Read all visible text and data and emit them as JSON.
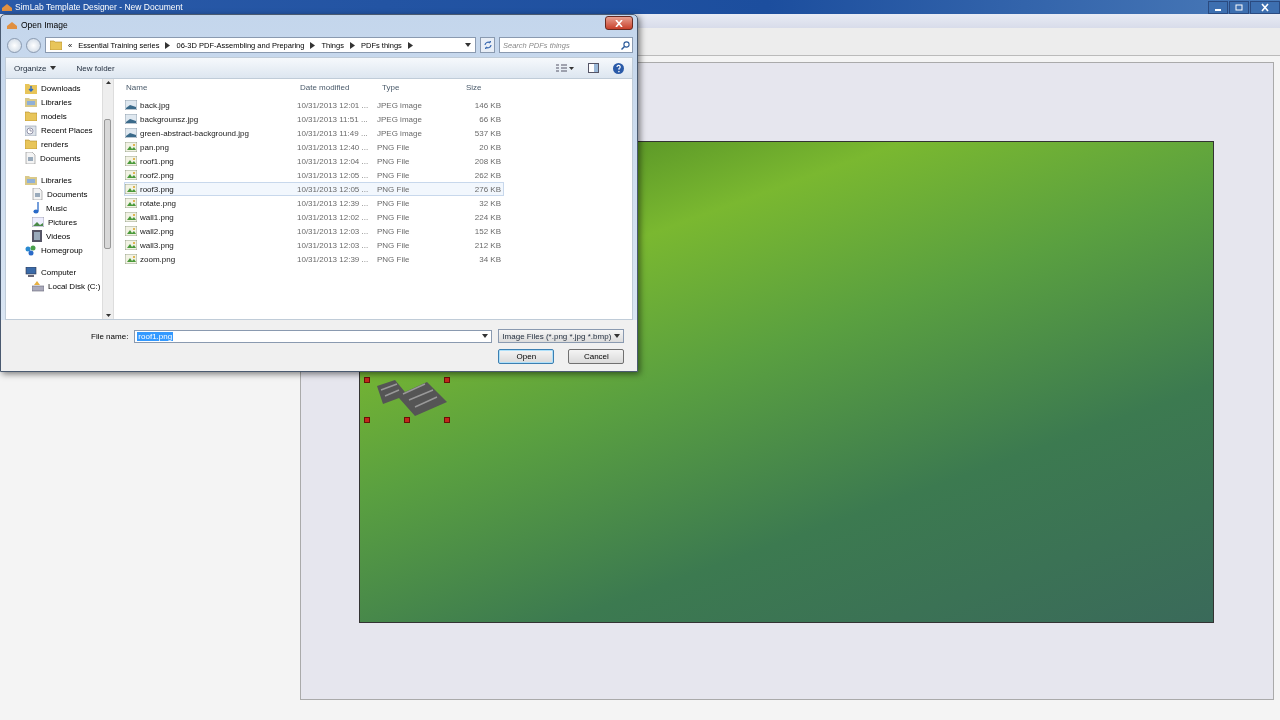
{
  "app": {
    "title": "SimLab Template Designer - New Document"
  },
  "canvas": {
    "items": [
      {
        "kind": "background",
        "selected": false
      },
      {
        "kind": "roof",
        "selected": true
      }
    ]
  },
  "dialog": {
    "title": "Open Image",
    "overflow_mark": "«",
    "breadcrumbs": [
      "Essential Training series",
      "06-3D PDF-Assembling and Preparing",
      "Things",
      "PDFs things"
    ],
    "search": {
      "placeholder": "Search PDFs things"
    },
    "commands": [
      {
        "label": "Organize",
        "dropdown": true
      },
      {
        "label": "New folder",
        "dropdown": false
      }
    ],
    "nav": [
      {
        "label": "Downloads",
        "kind": "downloads"
      },
      {
        "label": "Libraries",
        "kind": "library"
      },
      {
        "label": "models",
        "kind": "folder"
      },
      {
        "label": "Recent Places",
        "kind": "recent"
      },
      {
        "label": "renders",
        "kind": "folder"
      },
      {
        "label": "Documents",
        "kind": "document"
      },
      {
        "label": "Libraries",
        "kind": "library",
        "children": [
          {
            "label": "Documents",
            "kind": "document"
          },
          {
            "label": "Music",
            "kind": "music"
          },
          {
            "label": "Pictures",
            "kind": "pictures"
          },
          {
            "label": "Videos",
            "kind": "videos"
          }
        ]
      },
      {
        "label": "Homegroup",
        "kind": "homegroup"
      },
      {
        "label": "Computer",
        "kind": "computer",
        "children": [
          {
            "label": "Local Disk (C:)",
            "kind": "disk"
          }
        ]
      }
    ],
    "columns": [
      "Name",
      "Date modified",
      "Type",
      "Size"
    ],
    "files": [
      {
        "name": "back.jpg",
        "date": "10/31/2013 12:01 ...",
        "type": "JPEG image",
        "size": "146 KB",
        "kind": "jpeg",
        "selected": false
      },
      {
        "name": "backgrounsz.jpg",
        "date": "10/31/2013 11:51 ...",
        "type": "JPEG image",
        "size": "66 KB",
        "kind": "jpeg",
        "selected": false
      },
      {
        "name": "green-abstract-background.jpg",
        "date": "10/31/2013 11:49 ...",
        "type": "JPEG image",
        "size": "537 KB",
        "kind": "jpeg",
        "selected": false
      },
      {
        "name": "pan.png",
        "date": "10/31/2013 12:40 ...",
        "type": "PNG File",
        "size": "20 KB",
        "kind": "png",
        "selected": false
      },
      {
        "name": "roof1.png",
        "date": "10/31/2013 12:04 ...",
        "type": "PNG File",
        "size": "208 KB",
        "kind": "png",
        "selected": false
      },
      {
        "name": "roof2.png",
        "date": "10/31/2013 12:05 ...",
        "type": "PNG File",
        "size": "262 KB",
        "kind": "png",
        "selected": false
      },
      {
        "name": "roof3.png",
        "date": "10/31/2013 12:05 ...",
        "type": "PNG File",
        "size": "276 KB",
        "kind": "png",
        "selected": true
      },
      {
        "name": "rotate.png",
        "date": "10/31/2013 12:39 ...",
        "type": "PNG File",
        "size": "32 KB",
        "kind": "png",
        "selected": false
      },
      {
        "name": "wall1.png",
        "date": "10/31/2013 12:02 ...",
        "type": "PNG File",
        "size": "224 KB",
        "kind": "png",
        "selected": false
      },
      {
        "name": "wall2.png",
        "date": "10/31/2013 12:03 ...",
        "type": "PNG File",
        "size": "152 KB",
        "kind": "png",
        "selected": false
      },
      {
        "name": "wall3.png",
        "date": "10/31/2013 12:03 ...",
        "type": "PNG File",
        "size": "212 KB",
        "kind": "png",
        "selected": false
      },
      {
        "name": "zoom.png",
        "date": "10/31/2013 12:39 ...",
        "type": "PNG File",
        "size": "34 KB",
        "kind": "png",
        "selected": false
      }
    ],
    "file_name": {
      "label": "File name:",
      "value": "roof1.png"
    },
    "filter": "Image Files (*.png *.jpg *.bmp)",
    "buttons": [
      {
        "label": "Open",
        "kind": "default"
      },
      {
        "label": "Cancel",
        "kind": "normal"
      }
    ]
  }
}
